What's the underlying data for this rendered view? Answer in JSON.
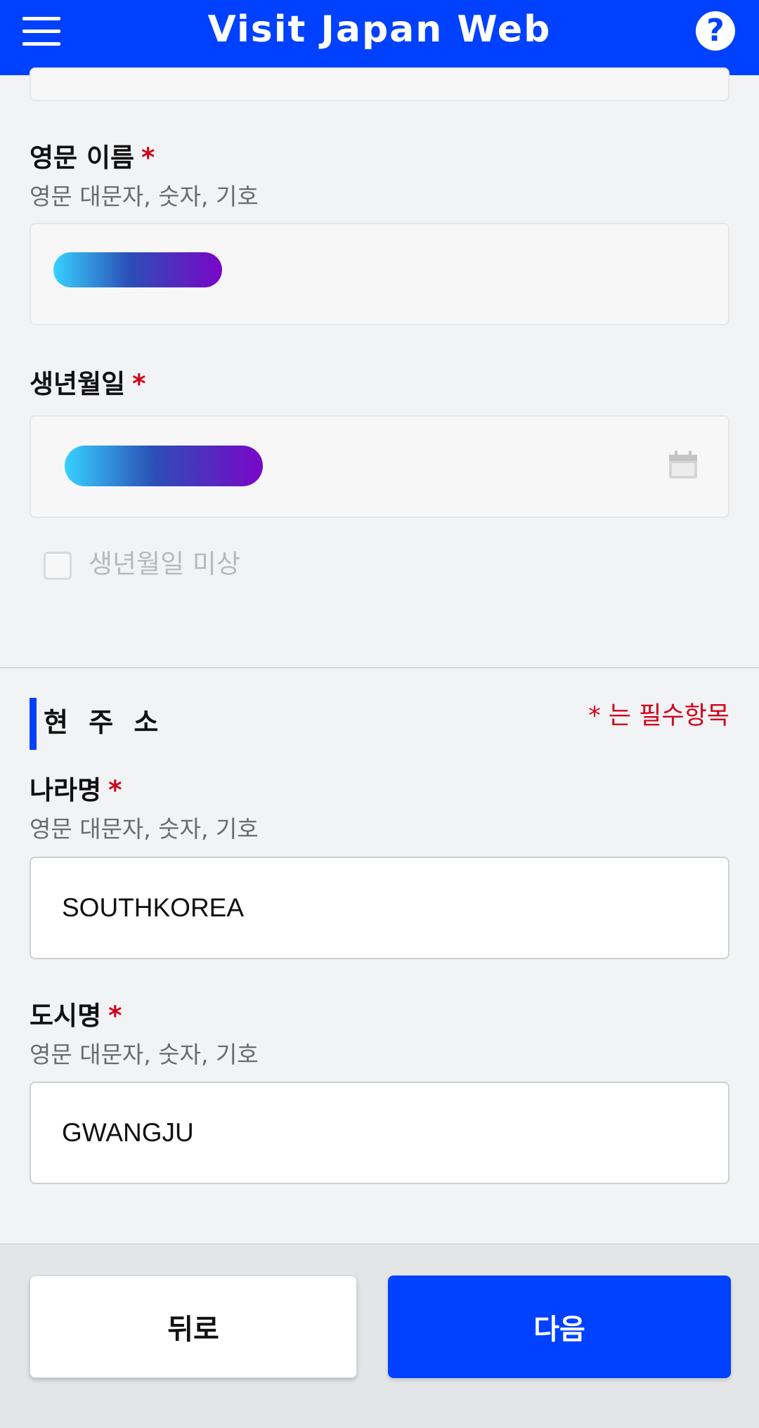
{
  "header": {
    "title": "Visit Japan Web",
    "menu_icon": "hamburger-menu-icon",
    "help_icon": "question-mark-icon",
    "help_glyph": "?"
  },
  "accent_color": "#0041ff",
  "required_color": "#d0021b",
  "required_mark": "*",
  "fields": {
    "english_name": {
      "label": "영문 이름",
      "hint": "영문 대문자, 숫자, 기호"
    },
    "birth_date": {
      "label": "생년월일",
      "icon": "calendar-icon"
    },
    "birth_unknown": {
      "label": "생년월일 미상",
      "checked": false
    }
  },
  "address_section": {
    "title": "현 주 소",
    "required_note": "* 는 필수항목",
    "country": {
      "label": "나라명",
      "hint": "영문 대문자, 숫자, 기호",
      "value": "SOUTHKOREA"
    },
    "city": {
      "label": "도시명",
      "hint": "영문 대문자, 숫자, 기호",
      "value": "GWANGJU"
    }
  },
  "footer": {
    "back_label": "뒤로",
    "next_label": "다음"
  }
}
